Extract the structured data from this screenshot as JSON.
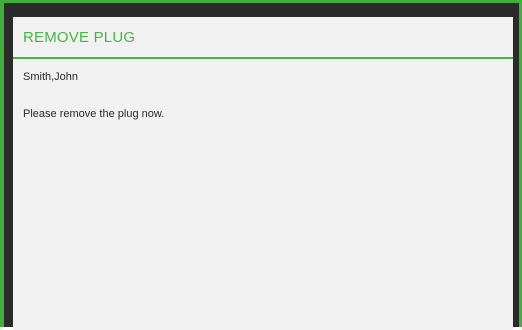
{
  "dialog": {
    "title": "REMOVE PLUG",
    "patient_name": "Smith,John",
    "message": "Please remove the plug now."
  },
  "colors": {
    "accent": "#45b545",
    "frame_border": "#3fb13a",
    "frame_background": "#2b2b2b",
    "dialog_background": "#f1f1f1",
    "text": "#2a2a2a"
  }
}
